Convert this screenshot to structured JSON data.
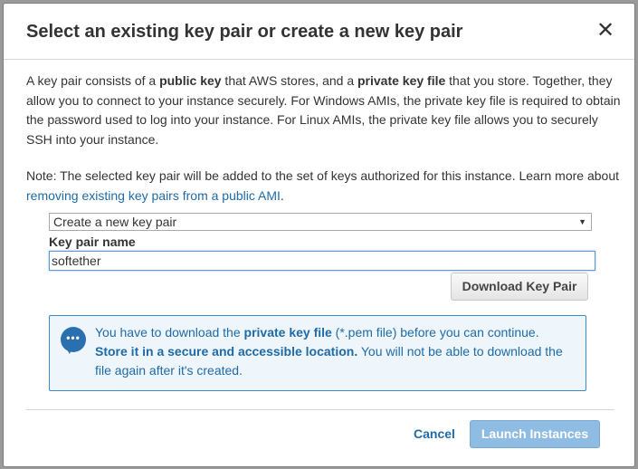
{
  "dialog": {
    "title": "Select an existing key pair or create a new key pair",
    "close_symbol": "✕",
    "close_icon": "close-icon"
  },
  "intro": {
    "p1": "A key pair consists of a ",
    "b1": "public key",
    "p2": " that AWS stores, and a ",
    "b2": "private key file",
    "p3": " that you store. Together, they allow you to connect to your instance securely. For Windows AMIs, the private key file is required to obtain the password used to log into your instance. For Linux AMIs, the private key file allows you to securely SSH into your instance."
  },
  "note": {
    "text": "Note: The selected key pair will be added to the set of keys authorized for this instance. Learn more about ",
    "link": "removing existing key pairs from a public AMI",
    "suffix": "."
  },
  "key_pair_select": {
    "selected": "Create a new key pair",
    "arrow_icon": "dropdown-arrow-icon"
  },
  "key_pair_name": {
    "label": "Key pair name",
    "value": "softether"
  },
  "download_button": "Download Key Pair",
  "info_box": {
    "icon": "chat-bubble-icon",
    "t1": "You have to download the ",
    "b1": "private key file",
    "t2": " (*.pem file) before you can continue.",
    "b2": "Store it in a secure and accessible location.",
    "t3": " You will not be able to download the file again after it's created."
  },
  "footer": {
    "cancel": "Cancel",
    "launch": "Launch Instances"
  },
  "colors": {
    "link": "#1e6ba8",
    "info_border": "#3d8bc4",
    "info_bg": "#eef5fb",
    "launch_bg": "#8fbce3"
  }
}
